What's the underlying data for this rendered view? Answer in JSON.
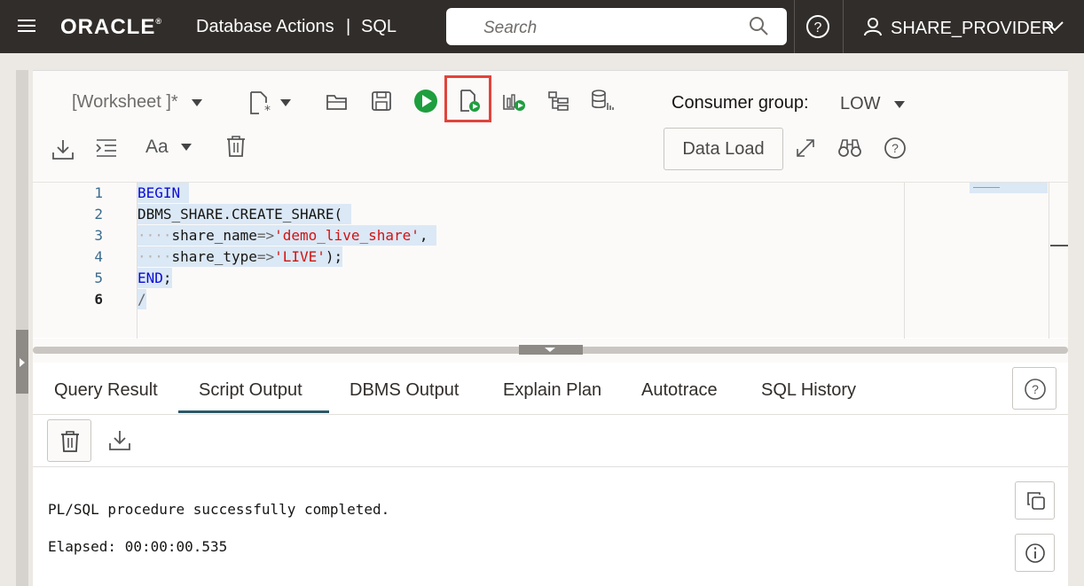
{
  "header": {
    "brand": "ORACLE",
    "app_title": "Database Actions",
    "separator": "|",
    "app_subtitle": "SQL",
    "search_placeholder": "Search",
    "user": "SHARE_PROVIDER"
  },
  "toolbar": {
    "worksheet": "[Worksheet ]*",
    "consumer_group_label": "Consumer group:",
    "consumer_group_value": "LOW",
    "data_load": "Data Load",
    "font_label": "Aa",
    "icons": [
      "new-worksheet-icon",
      "open-icon",
      "save-icon",
      "run-statement-icon",
      "run-script-icon",
      "autotrace-icon",
      "explain-plan-icon",
      "sql-tuning-icon",
      "download-icon",
      "format-icon",
      "clear-icon",
      "expand-icon",
      "binoculars-icon",
      "help-icon"
    ],
    "highlight_color": "#e0443b",
    "run_color": "#1e9e3e"
  },
  "editor": {
    "line_numbers": [
      "1",
      "2",
      "3",
      "4",
      "5",
      "6"
    ],
    "lines": {
      "l1_kw": "BEGIN",
      "l2": "DBMS_SHARE.CREATE_SHARE(",
      "l3_dots": "····",
      "l3_name": "share_name",
      "l3_op": "=>",
      "l3_str": "'demo_live_share'",
      "l3_end": ",",
      "l4_dots": "····",
      "l4_name": "share_type",
      "l4_op": "=>",
      "l4_str": "'LIVE'",
      "l4_end": ");",
      "l5_kw": "END",
      "l5_end": ";",
      "l6": "/"
    }
  },
  "tabs": [
    "Query Result",
    "Script Output",
    "DBMS Output",
    "Explain Plan",
    "Autotrace",
    "SQL History"
  ],
  "active_tab": "Script Output",
  "output": {
    "line1": "PL/SQL procedure successfully completed.",
    "line2": "Elapsed: 00:00:00.535"
  }
}
